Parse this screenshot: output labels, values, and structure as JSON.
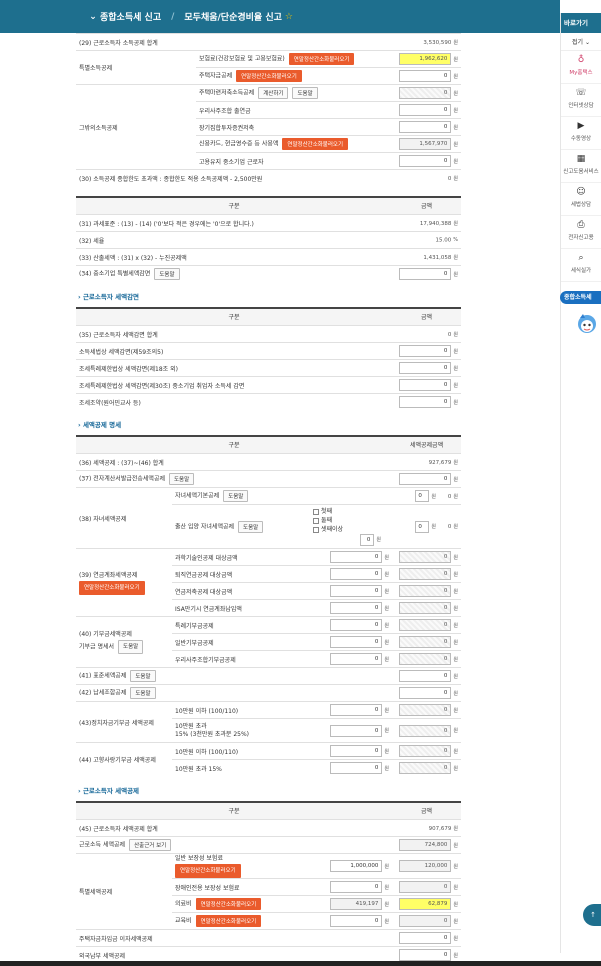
{
  "topbar": {
    "chevron": "⌄",
    "crumb1": "종합소득세 신고",
    "crumb2": "모두채움/단순경비율 신고",
    "star": "☆"
  },
  "unit": "원",
  "unit_pct": "%",
  "btn": {
    "help": "도움말",
    "calc": "계산하기",
    "orange": "연말정산간소화불러오기",
    "basis": "산출근거 보기"
  },
  "s1": {
    "r29": {
      "label": "(29) 근로소득자 소득공제 합계",
      "value": "3,530,590"
    },
    "special_label": "특별소득공제",
    "ins_label": "보험료(건강보험료 및 고용보험료)",
    "ins_value": "1,962,620",
    "house_label": "주택자금공제",
    "house_value": "0",
    "other_label": "그밖의소득공제",
    "house_savings_label": "주택마련저축소득공제",
    "house_savings_value": "0",
    "coop_label": "우리사주조합 출연금",
    "coop_value": "0",
    "longfund_label": "장기집합투자증권저축",
    "longfund_value": "0",
    "card_label": "신용카드, 현금영수증 등 사용액",
    "card_value": "1,567,970",
    "employ_label": "고용유지 중소기업 근로자",
    "employ_value": "0",
    "r30": {
      "label": "(30) 소득공제 종합한도 초과액 : 종합한도 적용 소득공제액 - 2,500만원",
      "value": "0"
    }
  },
  "s2": {
    "h_item": "구분",
    "h_amount": "금액",
    "r31": {
      "label": "(31) 과세표준 : (13) - (14) ('0'보다 적은 경우에는 '0'으로 합니다.)",
      "value": "17,940,388"
    },
    "r32": {
      "label": "(32) 세율",
      "value": "15.00"
    },
    "r33": {
      "label": "(33) 산출세액 : (31) x (32) - 누진공제액",
      "value": "1,431,058"
    },
    "r34": {
      "label": "(34) 중소기업 특별세액감면",
      "value": "0"
    }
  },
  "s3": {
    "title": "근로소득자 세액감면",
    "h_item": "구분",
    "h_amount": "금액",
    "rows": [
      {
        "label": "(35) 근로소득자 세액감면 합계",
        "value": "0"
      },
      {
        "label": "소득세법상 세액감면(제59조의5)",
        "value": "0"
      },
      {
        "label": "조세특례제한법상 세액감면(제18조 외)",
        "value": "0"
      },
      {
        "label": "조세특례제한법상 세액감면(제30조) 중소기업 취업자 소득세 감면",
        "value": "0"
      },
      {
        "label": "조세조약(원어민교사 등)",
        "value": "0"
      }
    ]
  },
  "s4": {
    "title": "세액공제 명세",
    "h_item": "구분",
    "h_amount": "세액공제금액",
    "r36": {
      "label": "(36) 세액공제 : (37)~(46) 합계",
      "value": "927,679"
    },
    "r37": {
      "label": "(37) 전자계산서발급전송세액공제",
      "value": "0"
    },
    "r38_label": "(38) 자녀세액공제",
    "child_basic_label": "자녀세액기본공제",
    "child_basic_count": "0",
    "child_basic_value": "0",
    "birth_label": "출산 입양 자녀세액공제",
    "opt1": "첫째",
    "opt2": "둘째",
    "opt3": "셋째이상",
    "birth_count": "0",
    "birth_count2": "0",
    "birth_value": "0",
    "r39_label": "(39) 연금계좌세액공제",
    "sci_label": "과학기술인공제 대상금액",
    "retire_label": "퇴직연금공제 대상금액",
    "pension_label": "연금저축공제 대상금액",
    "isa_label": "ISA만기시 연금계좌납입액",
    "r40_label": "(40) 기부금세액공제",
    "r40_sub": "기부금 명세서",
    "special_donation_label": "특례기부금공제",
    "general_donation_label": "일반기부금공제",
    "coop_donation_label": "우리사주조합기부금공제",
    "r41_label": "(41) 표준세액공제",
    "r42_label": "(42) 납세조합공제",
    "r43_label": "(43)정치자금기부금 세액공제",
    "pol_a_label": "10만원 이하 (100/110)",
    "pol_b_label1": "10만원 초과",
    "pol_b_label2": "15% (3천만원 초과분 25%)",
    "r44_label": "(44) 고향사랑기부금 세액공제",
    "home_a_label": "10만원 이하 (100/110)",
    "home_b_label": "10만원 초과 15%",
    "zero": "0"
  },
  "s5": {
    "title": "근로소득자 세액공제",
    "h_item": "구분",
    "h_amount": "금액",
    "r45": {
      "label": "(45) 근로소득자 세액공제 합계",
      "value": "907,679"
    },
    "earned_label": "근로소득 세액공제",
    "earned_value": "724,800",
    "special_label": "특별세액공제",
    "gen_ins_label": "일반 보장성 보험료",
    "gen_ins_input": "1,000,000",
    "gen_ins_value": "120,000",
    "dis_ins_label": "장애인전용 보장성 보험료",
    "dis_ins_value": "0",
    "medical_label": "의료비",
    "medical_input": "419,197",
    "medical_value": "62,879",
    "edu_label": "교육비",
    "edu_input": "0",
    "edu_value": "0",
    "loan_label": "주택자금차입금 이자세액공제",
    "loan_value": "0",
    "foreign_label": "외국납부 세액공제",
    "foreign_value": "0"
  },
  "sidebar": {
    "header": "바로가기",
    "fold": "접기 ⌄",
    "items": [
      {
        "icon": "♁",
        "label": "My홈택스"
      },
      {
        "icon": "☏",
        "label": "인터넷상담"
      },
      {
        "icon": "▶",
        "label": "수동영상"
      },
      {
        "icon": "▦",
        "label": "신고도움서비스"
      },
      {
        "icon": "☺",
        "label": "세법상담"
      },
      {
        "icon": "⎙",
        "label": "전자신고용"
      },
      {
        "icon": "⌕",
        "label": "세식실가"
      }
    ],
    "pill": "종합소득세",
    "fab": "↑"
  }
}
